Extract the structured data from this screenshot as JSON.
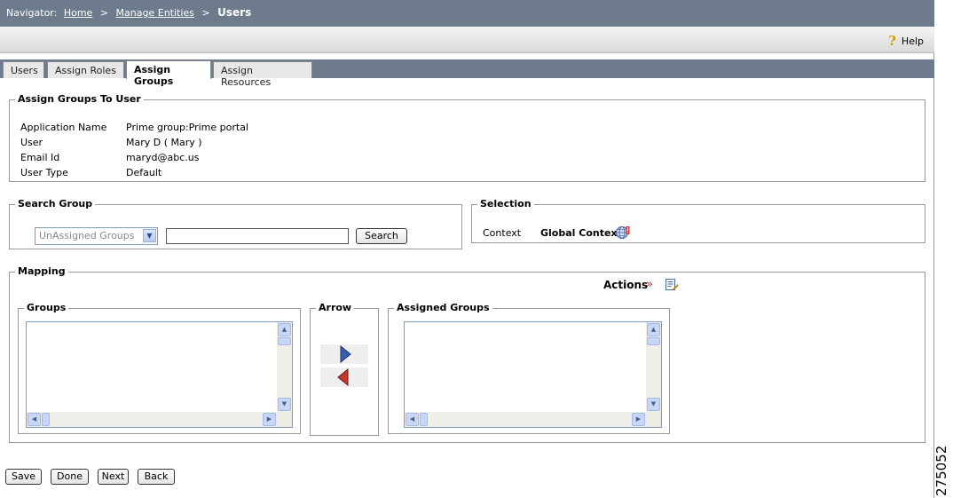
{
  "navigator": {
    "label": "Navigator:",
    "crumbs": [
      "Home",
      "Manage Entities"
    ],
    "separator": ">",
    "current": "Users"
  },
  "help": {
    "label": "Help",
    "icon": "question-mark-icon"
  },
  "tabs": [
    {
      "label": "Users",
      "active": false
    },
    {
      "label": "Assign Roles",
      "active": false
    },
    {
      "label": "Assign Groups",
      "active": true
    },
    {
      "label": "Assign Resources",
      "active": false
    }
  ],
  "assign_section": {
    "title": "Assign Groups To User",
    "rows": [
      {
        "label": "Application Name",
        "value": "Prime group:Prime portal"
      },
      {
        "label": "User",
        "value": "Mary D ( Mary )"
      },
      {
        "label": "Email Id",
        "value": "maryd@abc.us"
      },
      {
        "label": "User Type",
        "value": "Default"
      }
    ]
  },
  "search_group": {
    "title": "Search Group",
    "dropdown_selected": "UnAssigned Groups",
    "search_value": "",
    "search_button": "Search"
  },
  "selection": {
    "title": "Selection",
    "context_label": "Context",
    "context_value": "Global Context",
    "context_icon": "globe-alert-icon"
  },
  "mapping": {
    "title": "Mapping",
    "actions_label": "Actions",
    "actions_chevron": "»",
    "groups_title": "Groups",
    "arrow_title": "Arrow",
    "assigned_title": "Assigned Groups"
  },
  "buttons": {
    "save": "Save",
    "done": "Done",
    "next": "Next",
    "back": "Back"
  },
  "figure_number": "275052",
  "colors": {
    "header": "#6d7b8d",
    "arrow_right": "#3b5fb0",
    "arrow_left": "#c0392b"
  }
}
